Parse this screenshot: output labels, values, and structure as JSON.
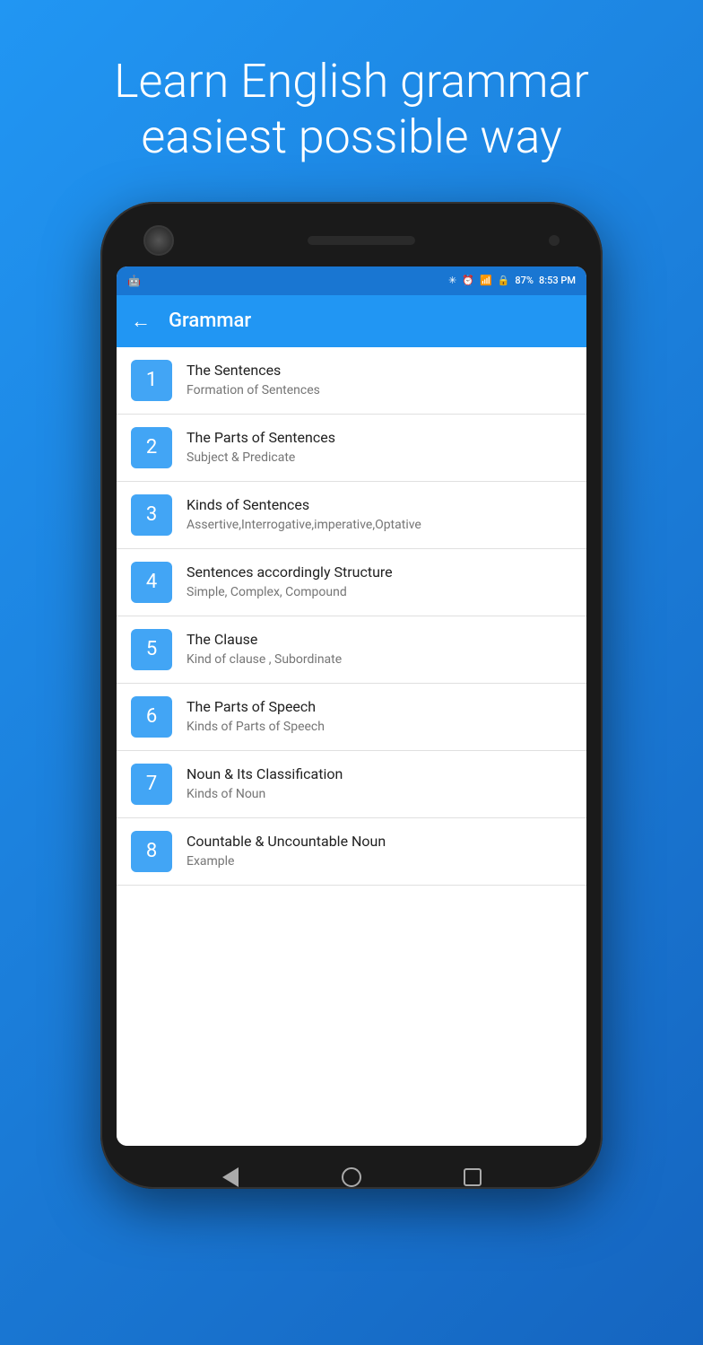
{
  "hero": {
    "line1": "Learn English grammar",
    "line2": "easiest possible way"
  },
  "status_bar": {
    "battery": "87%",
    "time": "8:53 PM"
  },
  "app_bar": {
    "title": "Grammar",
    "back_label": "←"
  },
  "items": [
    {
      "number": "1",
      "title": "The Sentences",
      "subtitle": "Formation of Sentences"
    },
    {
      "number": "2",
      "title": "The Parts of Sentences",
      "subtitle": "Subject & Predicate"
    },
    {
      "number": "3",
      "title": "Kinds of Sentences",
      "subtitle": "Assertive,Interrogative,imperative,Optative"
    },
    {
      "number": "4",
      "title": "Sentences accordingly Structure",
      "subtitle": "Simple, Complex, Compound"
    },
    {
      "number": "5",
      "title": "The Clause",
      "subtitle": "Kind of clause , Subordinate"
    },
    {
      "number": "6",
      "title": "The Parts of Speech",
      "subtitle": "Kinds of Parts of Speech"
    },
    {
      "number": "7",
      "title": "Noun & Its Classification",
      "subtitle": "Kinds of Noun"
    },
    {
      "number": "8",
      "title": "Countable & Uncountable Noun",
      "subtitle": "Example"
    }
  ]
}
